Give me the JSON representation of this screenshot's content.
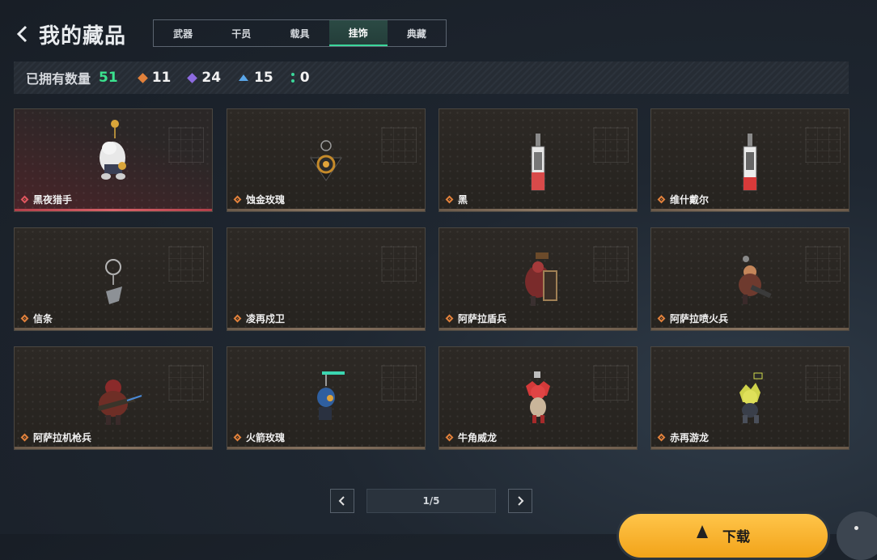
{
  "header": {
    "back_icon": "chevron-left-icon",
    "title": "我的藏品"
  },
  "tabs": [
    {
      "label": "武器",
      "active": false
    },
    {
      "label": "干员",
      "active": false
    },
    {
      "label": "载具",
      "active": false
    },
    {
      "label": "挂饰",
      "active": true
    },
    {
      "label": "典藏",
      "active": false
    }
  ],
  "stats": {
    "owned_label": "已拥有数量",
    "owned_count": "51",
    "counts": [
      {
        "icon": "orange-diamond-icon",
        "value": "11",
        "color": "#e2813b"
      },
      {
        "icon": "purple-diamond-icon",
        "value": "24",
        "color": "#8d6be0"
      },
      {
        "icon": "blue-chevron-icon",
        "value": "15",
        "color": "#5aa6e8"
      },
      {
        "icon": "green-dots-icon",
        "value": "0",
        "color": "#3bd69a"
      }
    ]
  },
  "items": [
    {
      "name": "黑夜猎手",
      "rarity": "red",
      "icon": "white-creature-charm-icon"
    },
    {
      "name": "蚀金玫瑰",
      "rarity": "orange",
      "icon": "dark-rose-pendant-icon"
    },
    {
      "name": "黑",
      "rarity": "orange",
      "icon": "card-tag-charm-icon"
    },
    {
      "name": "维什戴尔",
      "rarity": "orange",
      "icon": "card-tag-charm-icon"
    },
    {
      "name": "信条",
      "rarity": "orange",
      "icon": "ring-pendant-charm-icon"
    },
    {
      "name": "凌再戍卫",
      "rarity": "orange",
      "icon": ""
    },
    {
      "name": "阿萨拉盾兵",
      "rarity": "orange",
      "icon": "shield-soldier-charm-icon"
    },
    {
      "name": "阿萨拉喷火兵",
      "rarity": "orange",
      "icon": "flamethrower-soldier-charm-icon"
    },
    {
      "name": "阿萨拉机枪兵",
      "rarity": "orange",
      "icon": "gunner-soldier-charm-icon"
    },
    {
      "name": "火箭玫瑰",
      "rarity": "orange",
      "icon": "rocket-rose-charm-icon"
    },
    {
      "name": "牛角威龙",
      "rarity": "orange",
      "icon": "horned-dragon-charm-icon"
    },
    {
      "name": "赤再游龙",
      "rarity": "orange",
      "icon": "yellow-dragon-charm-icon"
    }
  ],
  "pager": {
    "prev_icon": "chevron-left-icon",
    "next_icon": "chevron-right-icon",
    "page_text": "1/5"
  },
  "download": {
    "label": "下载",
    "icon": "arrow-up-icon"
  },
  "more_icon": "more-vertical-icon"
}
